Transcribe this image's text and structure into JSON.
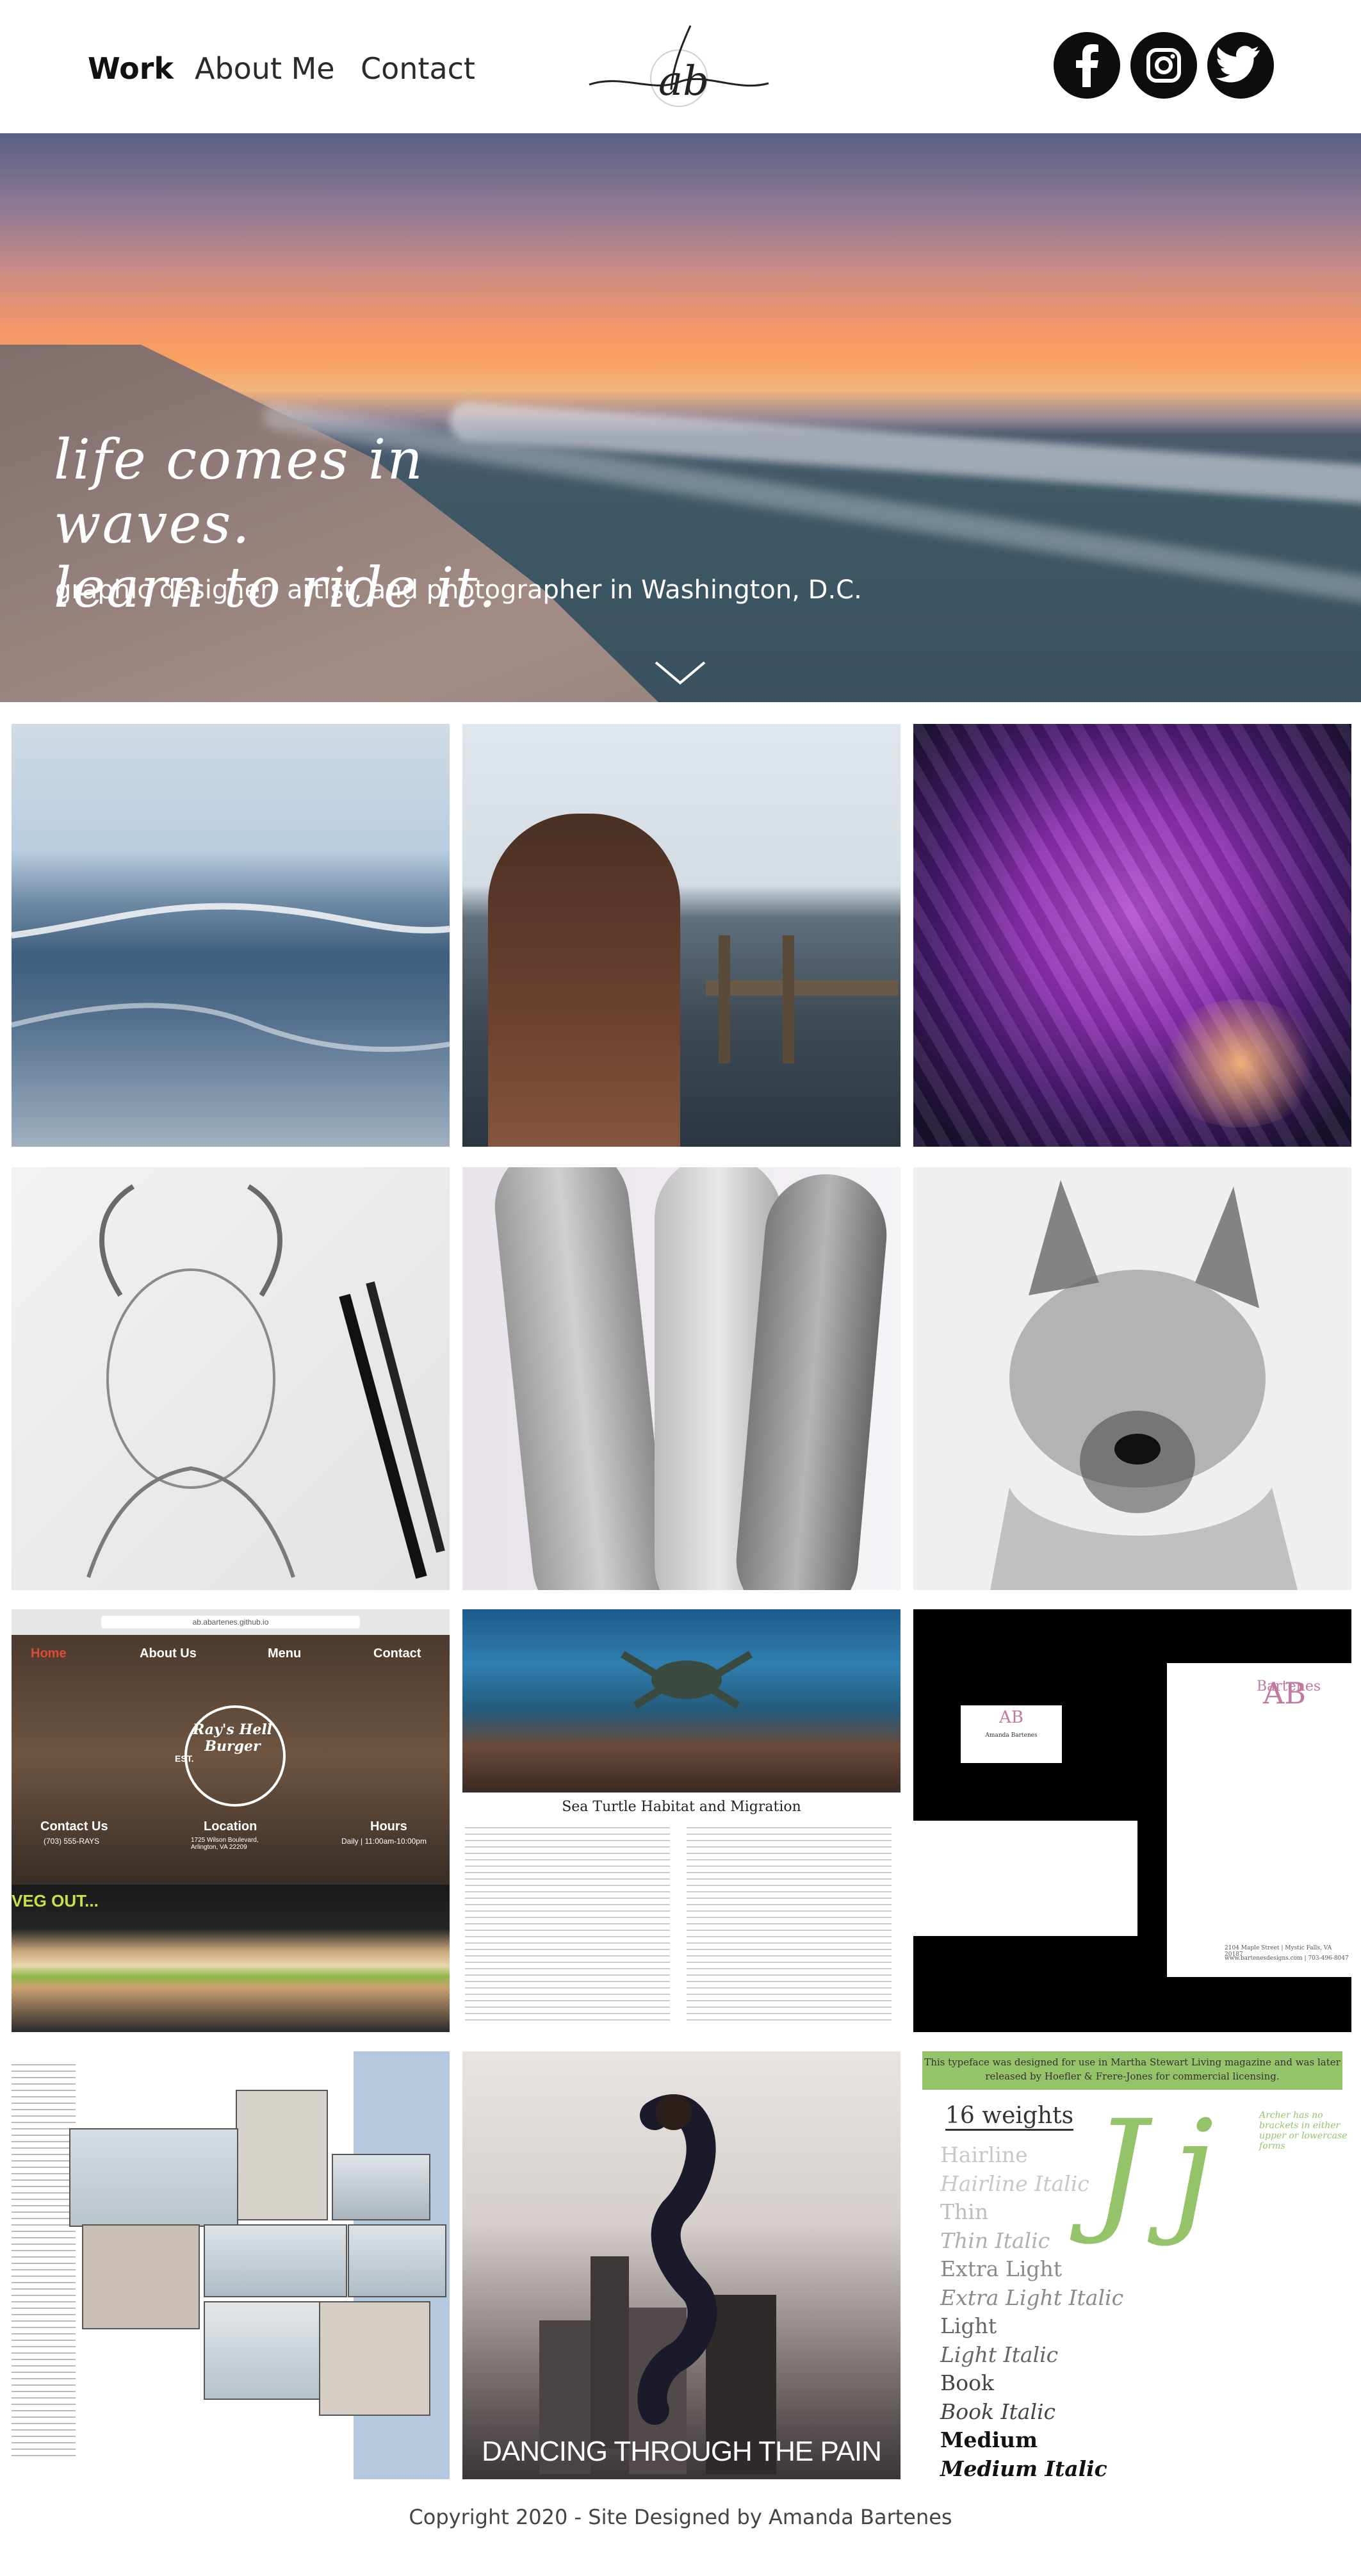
{
  "nav": {
    "links": [
      "Work",
      "About Me",
      "Contact"
    ],
    "logo_text": "ab",
    "social_icons": [
      "facebook-icon",
      "instagram-icon",
      "twitter-icon"
    ]
  },
  "hero": {
    "tagline": "life comes in waves.\nlearn to ride it.",
    "subtitle": "graphic designer, artist, and photographer in Washington, D.C.",
    "scroll_icon": "chevron-down-icon"
  },
  "gallery": {
    "restaurant": {
      "url": "ab.abartenes.github.io",
      "nav": [
        "Home",
        "About Us",
        "Menu",
        "Contact"
      ],
      "brand": "Ray's Hell Burger",
      "est": "EST.",
      "footer_labels": [
        "Contact Us",
        "Location",
        "Hours"
      ],
      "footer_values": [
        "(703) 555-RAYS",
        "1725 Wilson Boulevard, Arlington, VA 22209",
        "Daily | 11:00am-10:00pm"
      ],
      "veg": "VEG OUT..."
    },
    "turtle": {
      "title": "Sea Turtle Habitat and Migration"
    },
    "stationery": {
      "brand": "AB",
      "name": "Bartenes",
      "card_name": "Amanda Bartenes",
      "address": "2104 Maple Street | Mystic Falls, VA 20187",
      "web": "www.bartenesdesigns.com | 703-496-8047"
    },
    "surfposter": {
      "text": "DANCING THROUGH THE PAIN"
    },
    "typeface": {
      "banner": "This typeface was designed for use in Martha Stewart Living magazine and was later released by Hoefler & Frere-Jones for commercial licensing.",
      "heading": "16 weights",
      "annotation": "Archer has no brackets in either upper or lowercase forms",
      "weights": [
        "Hairline",
        "Hairline Italic",
        "Thin",
        "Thin Italic",
        "Extra Light",
        "Extra Light Italic",
        "Light",
        "Light Italic",
        "Book",
        "Book Italic",
        "Medium",
        "Medium Italic"
      ],
      "glyph": "Jj"
    }
  },
  "footer": {
    "copyright": "Copyright 2020 - Site Designed by Amanda Bartenes"
  },
  "colors": {
    "accent_green": "#95c36a",
    "dark": "#0d0d0d"
  }
}
